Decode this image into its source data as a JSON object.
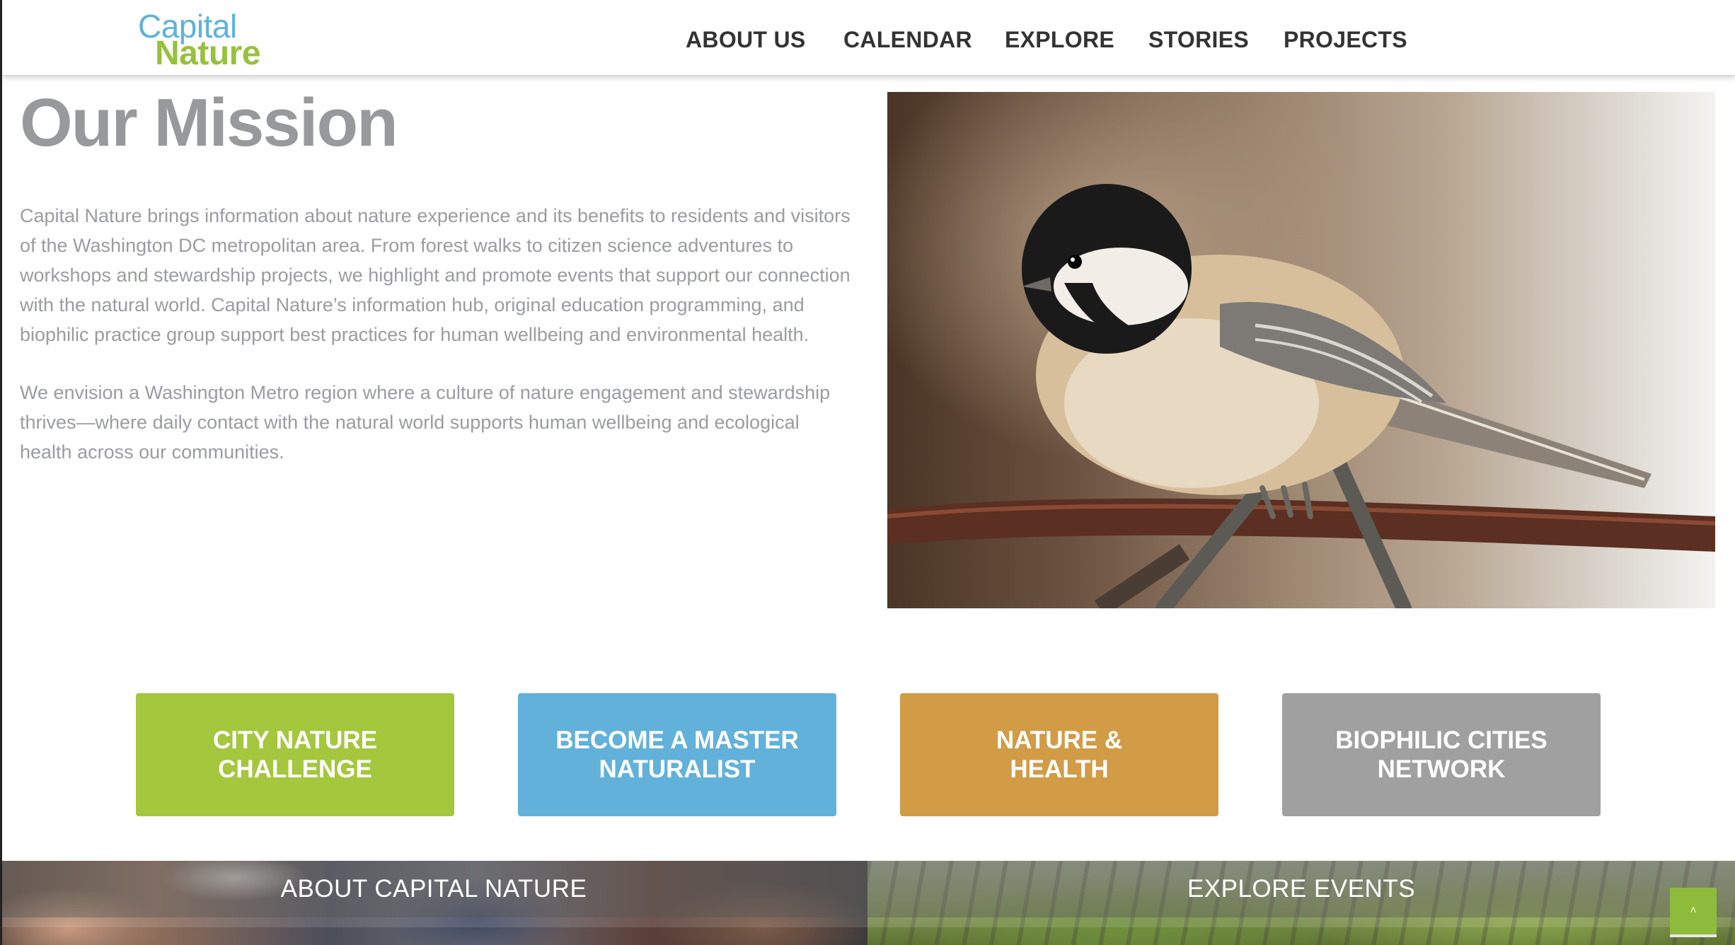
{
  "logo": {
    "line1": "Capital",
    "line2": "Nature"
  },
  "nav": {
    "items": [
      {
        "label": "ABOUT US"
      },
      {
        "label": "CALENDAR"
      },
      {
        "label": "EXPLORE"
      },
      {
        "label": "STORIES"
      },
      {
        "label": "PROJECTS"
      }
    ]
  },
  "mission": {
    "title": "Our Mission",
    "paragraph1": "Capital Nature brings information about nature experience and its benefits to residents and visitors of the Washington DC metropolitan area. From forest walks to citizen science adventures to workshops and stewardship projects, we highlight and promote events that support our connection with the natural world. Capital Nature’s  information hub, original education programming, and biophilic practice group support best practices for human wellbeing and environmental health.",
    "paragraph2": "We envision a Washington Metro region where a culture of nature engagement and stewardship thrives—where daily contact with the natural world supports human wellbeing  and ecological health across our communities."
  },
  "programs": [
    {
      "label": "CITY NATURE\nCHALLENGE",
      "color": "#a4c73e"
    },
    {
      "label": "BECOME A MASTER\nNATURALIST",
      "color": "#62b1da"
    },
    {
      "label": "NATURE &\nHEALTH",
      "color": "#d29b46"
    },
    {
      "label": "BIOPHILIC CITIES\nNETWORK",
      "color": "#a0a0a0"
    }
  ],
  "banners": {
    "left_title": "ABOUT CAPITAL NATURE",
    "right_title": "EXPLORE EVENTS"
  },
  "back_to_top": {
    "glyph": "˄",
    "icon": "chevron-up-icon"
  },
  "colors": {
    "green": "#97c13b",
    "blue": "#5eb2db",
    "text_gray": "#9a9c9f",
    "nav_text": "#333333"
  }
}
